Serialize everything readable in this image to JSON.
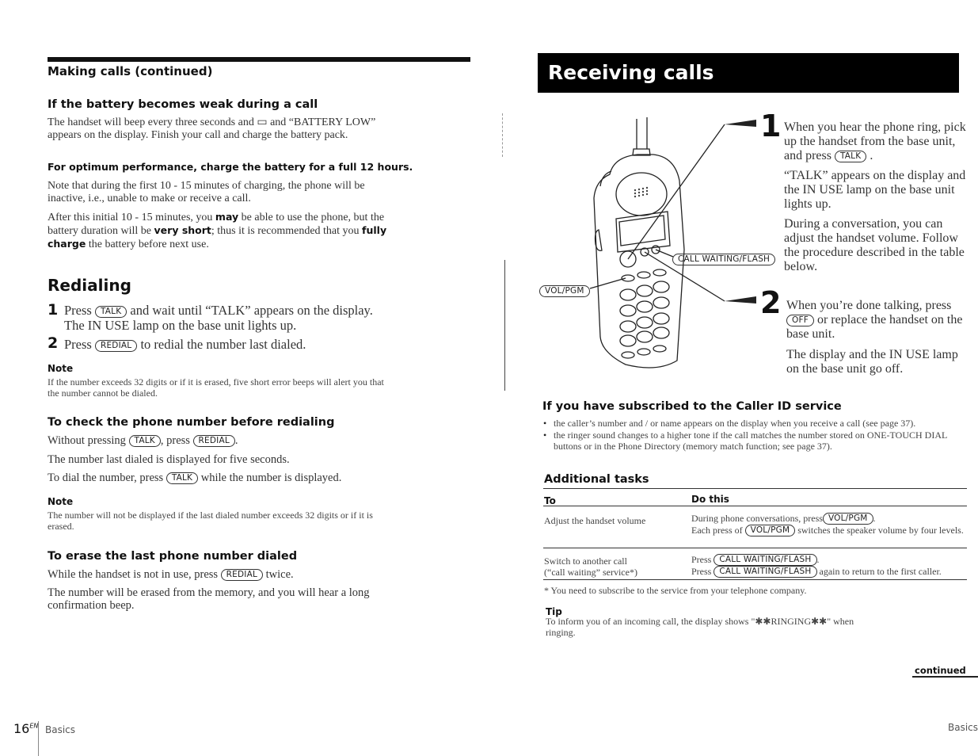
{
  "left_page": {
    "section_title": "Making calls (continued)",
    "battery": {
      "heading": "If the battery becomes weak during a call",
      "para1": "The handset will beep every three seconds and ▭ and  “BATTERY LOW” appears on the display. Finish your call and charge the battery pack.",
      "bold_line": "For optimum performance, charge the battery for a full 12 hours.",
      "para2": "Note that during the first 10 - 15 minutes of charging, the phone will be inactive, i.e., unable to make or receive a call.",
      "para3_a": "After this initial 10 - 15 minutes, you ",
      "para3_b": "may",
      "para3_c": " be able to use the phone, but the battery duration will be ",
      "para3_d": "very short",
      "para3_e": "; thus it is recommended that you ",
      "para3_f": "fully charge",
      "para3_g": " the battery before next use."
    },
    "redialing": {
      "heading": "Redialing",
      "steps": [
        {
          "num": "1",
          "pre": "Press ",
          "key": "TALK",
          "post": " and wait until “TALK” appears on the display.",
          "line2": "The IN USE lamp on the base unit lights up."
        },
        {
          "num": "2",
          "pre": "Press ",
          "key": "REDIAL",
          "post": " to redial the number last dialed."
        }
      ],
      "note_heading": "Note",
      "note_text": "If the number exceeds 32 digits or if it is erased, five short error beeps will alert you that the number cannot be dialed."
    },
    "check": {
      "heading": "To check the phone number before redialing",
      "line1_pre": "Without pressing ",
      "line1_key1": "TALK",
      "line1_mid": ", press ",
      "line1_key2": "REDIAL",
      "line1_post": ".",
      "line2": "The number last dialed is displayed for five seconds.",
      "line3_pre": "To dial the number, press ",
      "line3_key": "TALK",
      "line3_post": " while the number is displayed.",
      "note_heading": "Note",
      "note_text": "The number will not be displayed if the last dialed number exceeds 32 digits or if it is erased."
    },
    "erase": {
      "heading": "To erase the last phone number dialed",
      "line1_pre": "While the handset is not in use, press ",
      "line1_key": "REDIAL",
      "line1_post": " twice.",
      "line2": "The number will be erased from the memory, and you will hear a long confirmation beep."
    },
    "footer": {
      "page_number": "16",
      "page_suffix": "EN",
      "section": "Basics"
    }
  },
  "right_page": {
    "banner_title": "Receiving calls",
    "illustration": {
      "label_call_waiting": "CALL WAITING/FLASH",
      "label_vol": "VOL/PGM",
      "callout_1": "1",
      "callout_2": "2"
    },
    "step1": {
      "num": "1",
      "p1_pre": "When you hear the phone ring, pick up the handset from the base unit, and press ",
      "p1_key": "TALK",
      "p1_post": " .",
      "p2": "“TALK” appears on the display and the IN USE lamp on the base unit lights up.",
      "p3": "During a conversation, you can adjust the handset volume. Follow the procedure described in the table below."
    },
    "step2": {
      "num": "2",
      "p1_pre": "When you’re done talking, press ",
      "p1_key": "OFF",
      "p1_post": " or replace the handset on the base unit.",
      "p2": "The display and the IN USE lamp on the base unit go off."
    },
    "caller_id": {
      "heading": "If you have subscribed to the Caller ID service",
      "bullets": [
        "the caller’s number and / or name appears on the display when you receive a call (see page 37).",
        "the ringer sound changes to a higher tone if the call matches the number stored on ONE-TOUCH DIAL buttons or in the Phone Directory (memory match function; see page 37)."
      ]
    },
    "additional": {
      "heading": "Additional tasks",
      "col_to": "To",
      "col_do": "Do this",
      "rows": [
        {
          "to": "Adjust the handset volume",
          "do_l1_pre": "During phone conversations, press",
          "do_l1_key": "VOL/PGM",
          "do_l1_post": ".",
          "do_l2_pre": "Each press of ",
          "do_l2_key": "VOL/PGM",
          "do_l2_post": " switches the speaker volume by four levels."
        },
        {
          "to_l1": "Switch to another call",
          "to_l2": "(“call waiting” service*)",
          "do_l1_pre": "Press ",
          "do_l1_key": "CALL WAITING/FLASH",
          "do_l1_post": ".",
          "do_l2_pre": "Press ",
          "do_l2_key": "CALL WAITING/FLASH",
          "do_l2_post": " again to return to the first caller."
        }
      ],
      "footnote": "* You need to subscribe to the service from your telephone company."
    },
    "tip": {
      "heading": "Tip",
      "text": "To inform you of an incoming call, the display shows \"✱✱RINGING✱✱\" when ringing."
    },
    "continued": "continued",
    "footer_section": "Basics"
  }
}
